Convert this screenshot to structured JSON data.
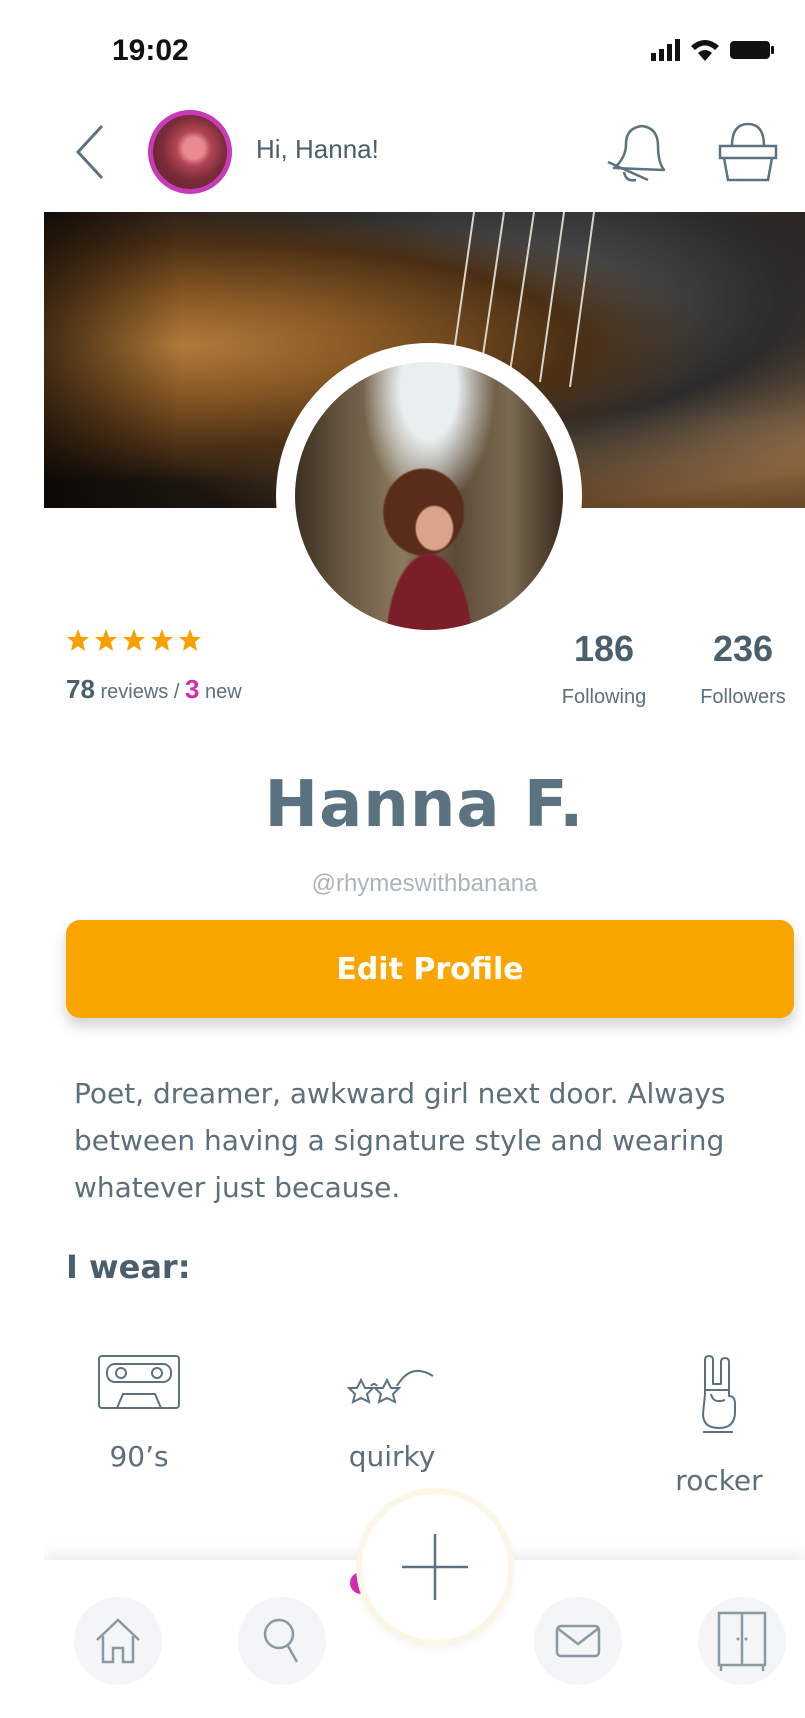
{
  "status_bar": {
    "time": "19:02"
  },
  "header": {
    "greeting": "Hi, Hanna!"
  },
  "profile": {
    "rating_stars": 5,
    "reviews_count": "78",
    "reviews_label": "reviews /",
    "new_count": "3",
    "new_label": "new",
    "following_count": "186",
    "following_label": "Following",
    "followers_count": "236",
    "followers_label": "Followers",
    "name": "Hanna F.",
    "handle": "@rhymeswithbanana",
    "edit_label": "Edit Profile",
    "bio": "Poet, dreamer, awkward girl next door. Always between having a signature style and wearing whatever just because."
  },
  "wear": {
    "title": "I wear:",
    "items": [
      {
        "label": "90’s",
        "icon": "cassette-icon"
      },
      {
        "label": "quirky",
        "icon": "star-glasses-icon"
      },
      {
        "label": "rocker",
        "icon": "rock-hand-icon"
      }
    ]
  },
  "nav": {
    "items": [
      "home-icon",
      "search-icon",
      "add-icon",
      "mail-icon",
      "closet-icon"
    ]
  },
  "colors": {
    "accent": "#fba600",
    "highlight": "#d42bb0",
    "text": "#4a5f6b",
    "star": "#f7a100"
  }
}
